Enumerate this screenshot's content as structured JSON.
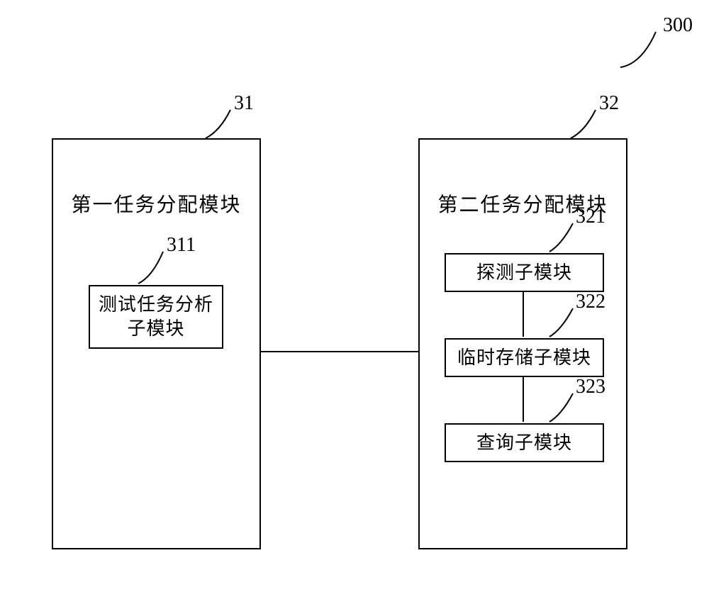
{
  "labels": {
    "system": "300",
    "module1": "31",
    "module2": "32",
    "sub311": "311",
    "sub321": "321",
    "sub322": "322",
    "sub323": "323"
  },
  "module1": {
    "title": "第一任务分配模块",
    "sub311": "测试任务分析子模块"
  },
  "module2": {
    "title": "第二任务分配模块",
    "sub321": "探测子模块",
    "sub322": "临时存储子模块",
    "sub323": "查询子模块"
  }
}
